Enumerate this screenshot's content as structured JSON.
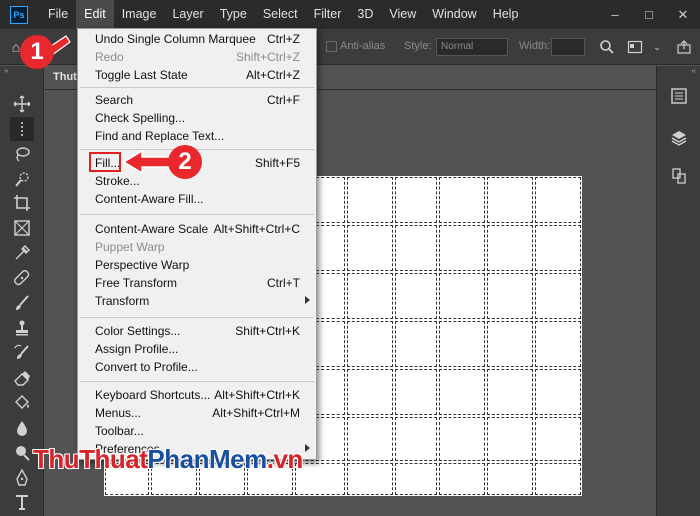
{
  "app": {
    "logo": "Ps"
  },
  "menubar": {
    "items": [
      "File",
      "Edit",
      "Image",
      "Layer",
      "Type",
      "Select",
      "Filter",
      "3D",
      "View",
      "Window",
      "Help"
    ],
    "active": "Edit"
  },
  "window_controls": {
    "minimize": "–",
    "restore": "□",
    "close": "✕"
  },
  "options_bar": {
    "antialias_label": "Anti-alias",
    "style_label": "Style:",
    "style_value": "Normal",
    "width_label": "Width:",
    "width_value": ""
  },
  "document": {
    "tab_label": "Thut"
  },
  "edit_menu": {
    "items": [
      {
        "label": "Undo Single Column Marquee",
        "shortcut": "Ctrl+Z",
        "disabled": false
      },
      {
        "label": "Redo",
        "shortcut": "Shift+Ctrl+Z",
        "disabled": true
      },
      {
        "label": "Toggle Last State",
        "shortcut": "Alt+Ctrl+Z",
        "disabled": false
      },
      {
        "label": "Search",
        "shortcut": "Ctrl+F",
        "disabled": false
      },
      {
        "label": "Check Spelling...",
        "shortcut": "",
        "disabled": false
      },
      {
        "label": "Find and Replace Text...",
        "shortcut": "",
        "disabled": false
      },
      {
        "label": "Fill...",
        "shortcut": "Shift+F5",
        "disabled": false
      },
      {
        "label": "Stroke...",
        "shortcut": "",
        "disabled": false
      },
      {
        "label": "Content-Aware Fill...",
        "shortcut": "",
        "disabled": false
      },
      {
        "label": "Content-Aware Scale",
        "shortcut": "Alt+Shift+Ctrl+C",
        "disabled": false
      },
      {
        "label": "Puppet Warp",
        "shortcut": "",
        "disabled": true
      },
      {
        "label": "Perspective Warp",
        "shortcut": "",
        "disabled": false
      },
      {
        "label": "Free Transform",
        "shortcut": "Ctrl+T",
        "disabled": false
      },
      {
        "label": "Transform",
        "shortcut": "",
        "disabled": false,
        "submenu": true
      },
      {
        "label": "Color Settings...",
        "shortcut": "Shift+Ctrl+K",
        "disabled": false
      },
      {
        "label": "Assign Profile...",
        "shortcut": "",
        "disabled": false
      },
      {
        "label": "Convert to Profile...",
        "shortcut": "",
        "disabled": false
      },
      {
        "label": "Keyboard Shortcuts...",
        "shortcut": "Alt+Shift+Ctrl+K",
        "disabled": false
      },
      {
        "label": "Menus...",
        "shortcut": "Alt+Shift+Ctrl+M",
        "disabled": false
      },
      {
        "label": "Toolbar...",
        "shortcut": "",
        "disabled": false
      },
      {
        "label": "Preferences",
        "shortcut": "",
        "disabled": false,
        "submenu": true
      }
    ]
  },
  "annotations": {
    "step1": "1",
    "step2": "2"
  },
  "watermark": {
    "part1": "ThuThuat",
    "part2": "PhanMem",
    "part3": ".vn"
  },
  "colors": {
    "annotation_red": "#e8282c",
    "menu_bg": "#f0f0f0",
    "app_bg": "#535353"
  }
}
